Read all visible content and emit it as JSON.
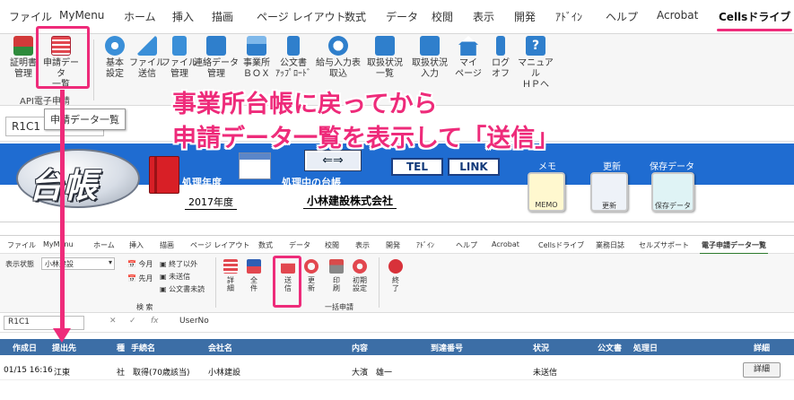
{
  "top_window": {
    "tabs": [
      "ファイル",
      "MyMenu",
      "ホーム",
      "挿入",
      "描画",
      "ページ レイアウト",
      "数式",
      "データ",
      "校閲",
      "表示",
      "開発",
      "ｱﾄﾞｲﾝ",
      "ヘルプ",
      "Acrobat",
      "Cellsドライブ"
    ],
    "active_tab": "Cellsドライブ",
    "ribbon_buttons": [
      {
        "label": "証明書\n管理",
        "icon": "certificate-icon"
      },
      {
        "label": "申請データ\n一覧",
        "icon": "application-list-icon"
      },
      {
        "label": "基本\n設定",
        "icon": "gear-icon"
      },
      {
        "label": "ファイル\n送信",
        "icon": "paper-plane-icon"
      },
      {
        "label": "ファイル\n管理",
        "icon": "file-icon"
      },
      {
        "label": "連絡データ\n管理",
        "icon": "contact-icon"
      },
      {
        "label": "事業所\nＢＯＸ",
        "icon": "box-icon"
      },
      {
        "label": "公文書\nｱｯﾌﾟﾛｰﾄﾞ",
        "icon": "upload-icon"
      },
      {
        "label": "給与入力表\n取込",
        "icon": "yen-icon"
      },
      {
        "label": "取扱状況\n一覧",
        "icon": "person-list-icon"
      },
      {
        "label": "取扱状況\n入力",
        "icon": "person-input-icon"
      },
      {
        "label": "マイ\nページ",
        "icon": "home-icon"
      },
      {
        "label": "ログ\nオフ",
        "icon": "key-icon"
      },
      {
        "label": "マニュアル\nＨＰへ",
        "icon": "help-icon"
      }
    ],
    "group_label": "API電子申請",
    "tooltip": "申請データ一覧",
    "name_box": "R1C1",
    "annotation_line1": "事業所台帳に戻ってから",
    "annotation_line2": "申請データ一覧を表示して「送信」",
    "banner": {
      "logo_text": "台帳",
      "year_label": "処理年度",
      "year_value": "2017年度",
      "current_label": "処理中の台帳",
      "company": "小林建設株式会社",
      "arrow_btn": "⇐⇒",
      "tel": "TEL",
      "link": "LINK",
      "memo_caption": "メモ",
      "memo_icon_label": "MEMO",
      "update_caption": "更新",
      "update_icon_label": "更新",
      "save_caption": "保存データ",
      "save_icon_label": "保存データ"
    }
  },
  "bottom_window": {
    "tabs": [
      "ファイル",
      "MyMenu",
      "ホーム",
      "挿入",
      "描画",
      "ページ レイアウト",
      "数式",
      "データ",
      "校閲",
      "表示",
      "開発",
      "ｱﾄﾞｲﾝ",
      "ヘルプ",
      "Acrobat",
      "Cellsドライブ",
      "業務日誌",
      "セルズサポート",
      "電子申請データ一覧"
    ],
    "active_tab": "電子申請データ一覧",
    "status_label": "表示状態",
    "status_value": "小林建設",
    "filter_today": "今月",
    "filter_prev": "先月",
    "filter_end": "終了以外",
    "filter_unsent": "未送信",
    "filter_unread": "公文書未読",
    "search_group": "検 索",
    "bulk_group": "一括申請",
    "buttons": [
      {
        "label": "詳\n細",
        "icon": "list-icon"
      },
      {
        "label": "全\n件",
        "icon": "all-icon"
      },
      {
        "label": "送\n信",
        "icon": "send-icon"
      },
      {
        "label": "更\n新",
        "icon": "refresh-icon"
      },
      {
        "label": "印\n刷",
        "icon": "print-icon"
      },
      {
        "label": "初期\n設定",
        "icon": "gear-icon"
      },
      {
        "label": "終\n了",
        "icon": "exit-icon"
      }
    ],
    "name_box": "R1C1",
    "formula_value": "UserNo",
    "table": {
      "headers": [
        "作成日",
        "提出先",
        "種",
        "手続名",
        "会社名",
        "内容",
        "到達番号",
        "状況",
        "公文書",
        "処理日",
        "詳細"
      ],
      "row": {
        "created": "01/15 16:16",
        "submit_to": "江東",
        "kind": "社",
        "procedure": "取得(70歳該当)",
        "company": "小林建設",
        "content": "大濱　雄一",
        "arrival_no": "",
        "status": "未送信",
        "document": "",
        "processed": "",
        "detail_button": "詳細"
      }
    }
  },
  "colors": {
    "highlight": "#ee2b7a",
    "banner_blue": "#1f6cd1",
    "table_header": "#3c6ea6"
  }
}
